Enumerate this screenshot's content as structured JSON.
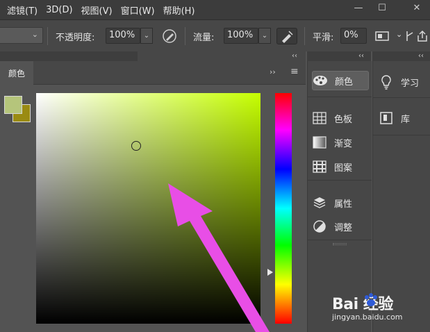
{
  "menu": {
    "items": [
      "滤镜(T)",
      "3D(D)",
      "视图(V)",
      "窗口(W)",
      "帮助(H)"
    ]
  },
  "window_controls": {
    "minimize": "—",
    "maximize": "☐",
    "close": "✕"
  },
  "options_bar": {
    "opacity_label": "不透明度:",
    "opacity_value": "100%",
    "flow_label": "流量:",
    "flow_value": "100%",
    "smoothing_label": "平滑:",
    "smoothing_value": "0%"
  },
  "color_panel": {
    "tab_label": "颜色",
    "collapse_glyph": "››",
    "menu_glyph": "≡",
    "foreground_color": "#b5c57b",
    "background_color": "#9a8b12",
    "hue_color": "#c6ff00"
  },
  "middle_dock": {
    "items": [
      {
        "label": "颜色",
        "icon": "palette-icon",
        "active": true
      },
      {
        "label": "色板",
        "icon": "swatches-grid-icon"
      },
      {
        "label": "渐变",
        "icon": "gradient-icon"
      },
      {
        "label": "图案",
        "icon": "pattern-icon"
      },
      {
        "label": "属性",
        "icon": "properties-icon"
      },
      {
        "label": "调整",
        "icon": "adjustments-icon"
      }
    ]
  },
  "right_dock": {
    "items": [
      {
        "label": "学习",
        "icon": "lightbulb-icon"
      },
      {
        "label": "库",
        "icon": "library-icon"
      }
    ]
  },
  "collapse": {
    "glyph": "‹‹"
  },
  "watermark": {
    "logo_text": "Bai  经验",
    "url": "jingyan.baidu.com"
  },
  "annotation_color": "#e84ee6"
}
